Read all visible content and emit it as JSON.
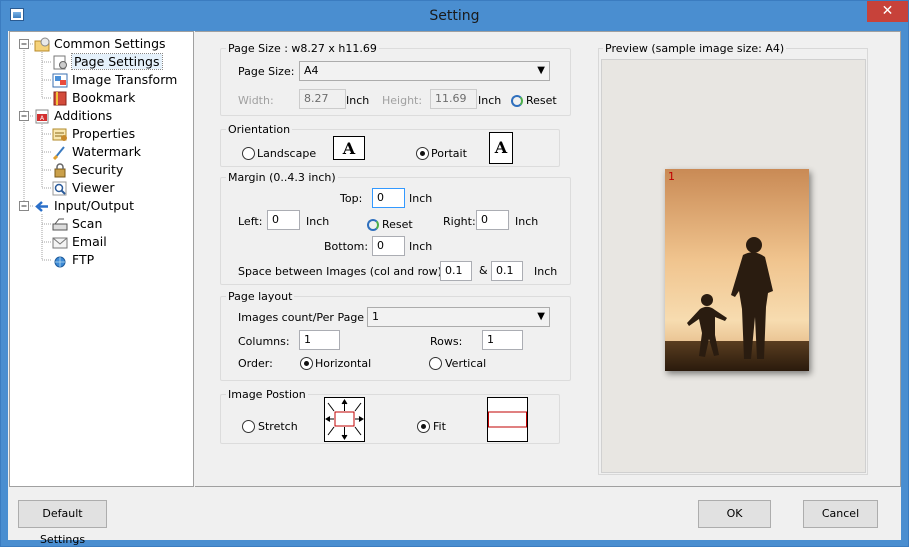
{
  "window": {
    "title": "Setting",
    "close_glyph": "✕"
  },
  "tree": {
    "items": [
      {
        "label": "Common Settings",
        "icon": "settings-folder-icon"
      },
      {
        "label": "Page Settings",
        "icon": "page-settings-icon",
        "selected": true
      },
      {
        "label": "Image Transform",
        "icon": "image-transform-icon"
      },
      {
        "label": "Bookmark",
        "icon": "bookmark-icon"
      },
      {
        "label": "Additions",
        "icon": "pdf-icon"
      },
      {
        "label": "Properties",
        "icon": "properties-icon"
      },
      {
        "label": "Watermark",
        "icon": "watermark-icon"
      },
      {
        "label": "Security",
        "icon": "security-icon"
      },
      {
        "label": "Viewer",
        "icon": "viewer-icon"
      },
      {
        "label": "Input/Output",
        "icon": "input-output-arrow-icon"
      },
      {
        "label": "Scan",
        "icon": "scanner-icon"
      },
      {
        "label": "Email",
        "icon": "email-icon"
      },
      {
        "label": "FTP",
        "icon": "ftp-globe-icon"
      }
    ]
  },
  "page_size": {
    "group_title": "Page Size : w8.27 x h11.69",
    "page_size_label": "Page Size:",
    "page_size_value": "A4",
    "width_label": "Width:",
    "width_value": "8.27",
    "height_label": "Height:",
    "height_value": "11.69",
    "unit": "Inch",
    "reset_label": "Reset"
  },
  "orientation": {
    "group_title": "Orientation",
    "landscape_label": "Landscape",
    "portrait_label": "Portait",
    "selected": "portrait",
    "glyph": "A"
  },
  "margin": {
    "group_title": "Margin (0..4.3 inch)",
    "top_label": "Top:",
    "top_value": "0",
    "left_label": "Left:",
    "left_value": "0",
    "right_label": "Right:",
    "right_value": "0",
    "bottom_label": "Bottom:",
    "bottom_value": "0",
    "unit": "Inch",
    "reset_label": "Reset",
    "space_label": "Space between Images (col and row) :",
    "space_col": "0.1",
    "space_amp": "&",
    "space_row": "0.1"
  },
  "page_layout": {
    "group_title": "Page layout",
    "count_label": "Images count/Per Page",
    "count_value": "1",
    "columns_label": "Columns:",
    "columns_value": "1",
    "rows_label": "Rows:",
    "rows_value": "1",
    "order_label": "Order:",
    "horizontal_label": "Horizontal",
    "vertical_label": "Vertical",
    "selected": "horizontal"
  },
  "image_position": {
    "group_title": "Image Postion",
    "stretch_label": "Stretch",
    "fit_label": "Fit",
    "selected": "fit"
  },
  "preview": {
    "title": "Preview (sample image size: A4)",
    "page_number": "1"
  },
  "buttons": {
    "default_settings": "Default Settings",
    "ok": "OK",
    "cancel": "Cancel"
  },
  "colors": {
    "title_bar": "#4a8ed0",
    "close_button": "#c7423a",
    "accent_red": "#c00000",
    "focus_border": "#3399ff"
  }
}
